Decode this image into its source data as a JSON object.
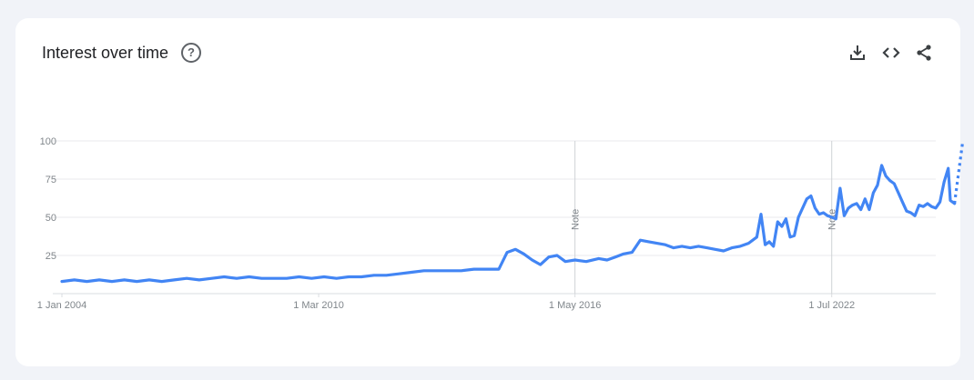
{
  "header": {
    "title": "Interest over time",
    "help_glyph": "?"
  },
  "toolbar": {
    "download_icon": "download-icon",
    "embed_icon": "embed-code-icon",
    "share_icon": "share-icon"
  },
  "chart_data": {
    "type": "line",
    "title": "Interest over time",
    "xlabel": "",
    "ylabel": "",
    "ylim": [
      0,
      100
    ],
    "y_ticks": [
      25,
      50,
      75,
      100
    ],
    "x_ticks": [
      "1 Jan 2004",
      "1 Mar 2010",
      "1 May 2016",
      "1 Jul 2022"
    ],
    "x_tick_years": [
      2004.0,
      2010.17,
      2016.33,
      2022.5
    ],
    "x_range": [
      2004.0,
      2025.0
    ],
    "grid": true,
    "line_color": "#4285f4",
    "annotations": [
      {
        "label": "Note",
        "x": 2016.33
      },
      {
        "label": "Note",
        "x": 2022.5
      }
    ],
    "series": [
      {
        "values": [
          [
            2004.0,
            8
          ],
          [
            2004.3,
            9
          ],
          [
            2004.6,
            8
          ],
          [
            2004.9,
            9
          ],
          [
            2005.2,
            8
          ],
          [
            2005.5,
            9
          ],
          [
            2005.8,
            8
          ],
          [
            2006.1,
            9
          ],
          [
            2006.4,
            8
          ],
          [
            2006.7,
            9
          ],
          [
            2007.0,
            10
          ],
          [
            2007.3,
            9
          ],
          [
            2007.6,
            10
          ],
          [
            2007.9,
            11
          ],
          [
            2008.2,
            10
          ],
          [
            2008.5,
            11
          ],
          [
            2008.8,
            10
          ],
          [
            2009.1,
            10
          ],
          [
            2009.4,
            10
          ],
          [
            2009.7,
            11
          ],
          [
            2010.0,
            10
          ],
          [
            2010.3,
            11
          ],
          [
            2010.6,
            10
          ],
          [
            2010.9,
            11
          ],
          [
            2011.2,
            11
          ],
          [
            2011.5,
            12
          ],
          [
            2011.8,
            12
          ],
          [
            2012.1,
            13
          ],
          [
            2012.4,
            14
          ],
          [
            2012.7,
            15
          ],
          [
            2013.0,
            15
          ],
          [
            2013.3,
            15
          ],
          [
            2013.6,
            15
          ],
          [
            2013.9,
            16
          ],
          [
            2014.2,
            16
          ],
          [
            2014.5,
            16
          ],
          [
            2014.7,
            27
          ],
          [
            2014.9,
            29
          ],
          [
            2015.1,
            26
          ],
          [
            2015.3,
            22
          ],
          [
            2015.5,
            19
          ],
          [
            2015.7,
            24
          ],
          [
            2015.9,
            25
          ],
          [
            2016.1,
            21
          ],
          [
            2016.33,
            22
          ],
          [
            2016.6,
            21
          ],
          [
            2016.9,
            23
          ],
          [
            2017.1,
            22
          ],
          [
            2017.3,
            24
          ],
          [
            2017.5,
            26
          ],
          [
            2017.7,
            27
          ],
          [
            2017.9,
            35
          ],
          [
            2018.1,
            34
          ],
          [
            2018.3,
            33
          ],
          [
            2018.5,
            32
          ],
          [
            2018.7,
            30
          ],
          [
            2018.9,
            31
          ],
          [
            2019.1,
            30
          ],
          [
            2019.3,
            31
          ],
          [
            2019.5,
            30
          ],
          [
            2019.7,
            29
          ],
          [
            2019.9,
            28
          ],
          [
            2020.1,
            30
          ],
          [
            2020.3,
            31
          ],
          [
            2020.5,
            33
          ],
          [
            2020.7,
            37
          ],
          [
            2020.8,
            52
          ],
          [
            2020.9,
            32
          ],
          [
            2021.0,
            34
          ],
          [
            2021.1,
            31
          ],
          [
            2021.2,
            47
          ],
          [
            2021.3,
            44
          ],
          [
            2021.4,
            49
          ],
          [
            2021.5,
            37
          ],
          [
            2021.6,
            38
          ],
          [
            2021.7,
            50
          ],
          [
            2021.9,
            62
          ],
          [
            2022.0,
            64
          ],
          [
            2022.1,
            56
          ],
          [
            2022.2,
            52
          ],
          [
            2022.3,
            53
          ],
          [
            2022.4,
            51
          ],
          [
            2022.5,
            50
          ],
          [
            2022.6,
            49
          ],
          [
            2022.7,
            69
          ],
          [
            2022.8,
            51
          ],
          [
            2022.9,
            56
          ],
          [
            2023.0,
            58
          ],
          [
            2023.1,
            59
          ],
          [
            2023.2,
            55
          ],
          [
            2023.3,
            62
          ],
          [
            2023.4,
            55
          ],
          [
            2023.5,
            66
          ],
          [
            2023.6,
            71
          ],
          [
            2023.7,
            84
          ],
          [
            2023.8,
            77
          ],
          [
            2023.9,
            74
          ],
          [
            2024.0,
            72
          ],
          [
            2024.1,
            66
          ],
          [
            2024.2,
            60
          ],
          [
            2024.3,
            54
          ],
          [
            2024.4,
            53
          ],
          [
            2024.5,
            51
          ],
          [
            2024.6,
            58
          ],
          [
            2024.7,
            57
          ],
          [
            2024.8,
            59
          ],
          [
            2024.9,
            57
          ],
          [
            2025.0,
            56
          ],
          [
            2025.1,
            60
          ],
          [
            2025.2,
            73
          ],
          [
            2025.3,
            82
          ],
          [
            2025.35,
            61
          ],
          [
            2025.45,
            59
          ]
        ],
        "partial": [
          [
            2025.45,
            59
          ],
          [
            2025.65,
            100
          ]
        ]
      }
    ]
  }
}
